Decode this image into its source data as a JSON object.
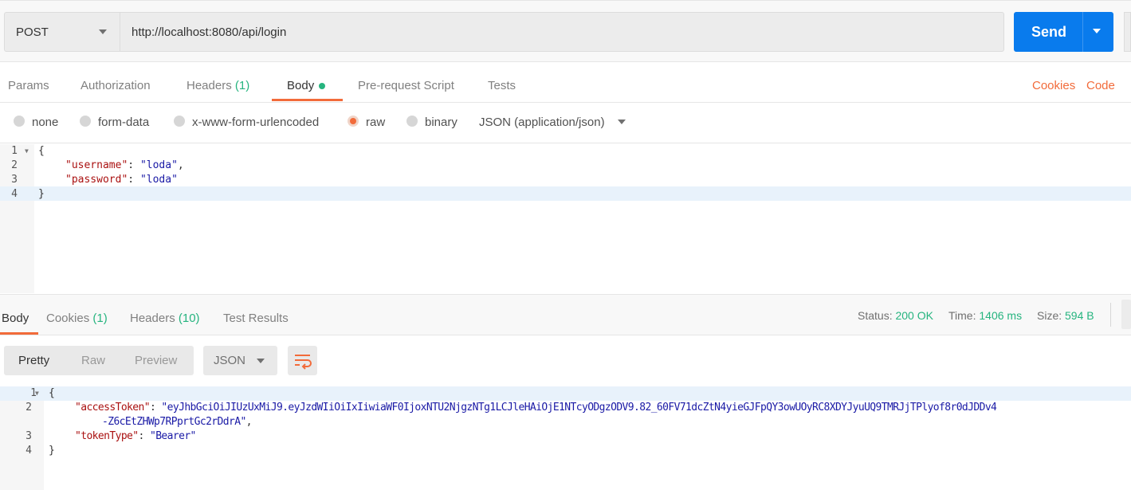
{
  "request": {
    "method": "POST",
    "url": "http://localhost:8080/api/login",
    "send_label": "Send"
  },
  "tabs": [
    {
      "label": "Params"
    },
    {
      "label": "Authorization"
    },
    {
      "label": "Headers",
      "count": "(1)"
    },
    {
      "label": "Body"
    },
    {
      "label": "Pre-request Script"
    },
    {
      "label": "Tests"
    }
  ],
  "right_links": {
    "cookies": "Cookies",
    "code": "Code"
  },
  "body_options": [
    "none",
    "form-data",
    "x-www-form-urlencoded",
    "raw",
    "binary"
  ],
  "body_type": "JSON (application/json)",
  "request_body": {
    "lines": [
      "1",
      "2",
      "3",
      "4"
    ],
    "l1": "{",
    "k1": "\"username\"",
    "v1": "\"loda\"",
    "k2": "\"password\"",
    "v2": "\"loda\"",
    "l4": "}"
  },
  "response_tabs": [
    {
      "label": "Body"
    },
    {
      "label": "Cookies",
      "count": "(1)"
    },
    {
      "label": "Headers",
      "count": "(10)"
    },
    {
      "label": "Test Results"
    }
  ],
  "status": {
    "status_label": "Status:",
    "status": "200 OK",
    "time_label": "Time:",
    "time": "1406 ms",
    "size_label": "Size:",
    "size": "594 B"
  },
  "view_modes": [
    "Pretty",
    "Raw",
    "Preview"
  ],
  "format": "JSON",
  "response_body": {
    "lines": [
      "1",
      "2",
      "3",
      "4"
    ],
    "k1": "\"accessToken\"",
    "v1a": "\"eyJhbGciOiJIUzUxMiJ9.eyJzdWIiOiIxIiwiaWF0IjoxNTU2NjgzNTg1LCJleHAiOjE1NTcyODgzODV9.82_60FV71dcZtN4yieGJFpQY3owUOyRC8XDYJyuUQ9TMRJjTPlyof8r0dJDDv4",
    "v1b": "-Z6cEtZHWp7RPprtGc2rDdrA\"",
    "k2": "\"tokenType\"",
    "v2": "\"Bearer\""
  }
}
